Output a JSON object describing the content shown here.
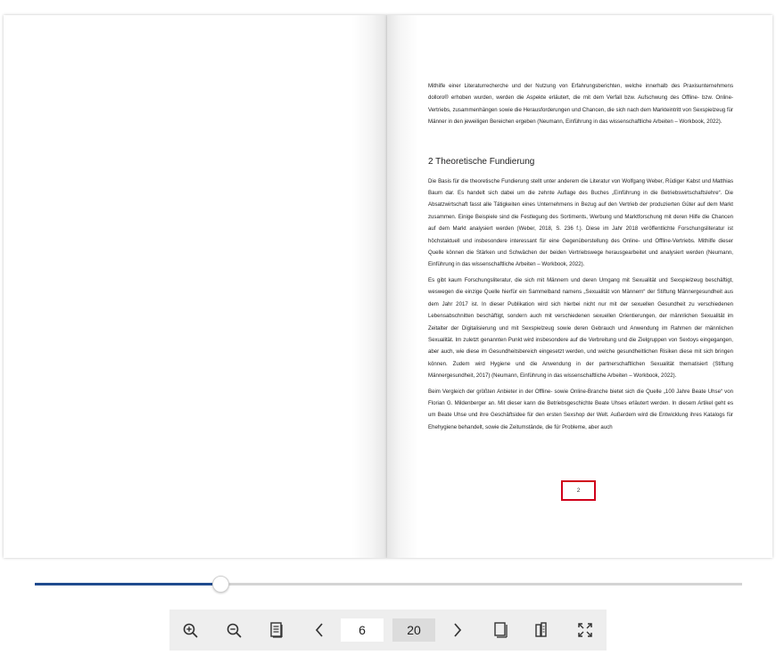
{
  "book": {
    "right_page": {
      "intro_paragraph": "Mithilfe einer Literaturrecherche und der Nutzung von Erfahrungsberichten, welche innerhalb des Praxisunternehmens dolloro® erhoben wurden, werden die Aspekte erläutert, die mit dem Verfall bzw. Aufschwung des Offline- bzw. Online-Vertriebs, zusammenhängen sowie die Herausforderungen und Chancen, die sich nach dem Markteintritt von Sexspielzeug für Männer in den jeweiligen Bereichen ergeben (Neumann, Einführung in das wissenschaftliche Arbeiten – Workbook, 2022).",
      "heading": "2 Theoretische Fundierung",
      "paragraphs": [
        "Die Basis für die theoretische Fundierung stellt unter anderem die Literatur von Wolfgang Weber, Rüdiger Kabst und Matthias Baum dar. Es handelt sich dabei um die zehnte Auflage des Buches „Einführung in die Betriebswirtschaftslehre“. Die Absatzwirtschaft fasst alle Tätigkeiten eines Unternehmens in Bezug auf den Vertrieb der produzierten Güter auf dem Markt zusammen. Einige Beispiele sind die Festlegung des Sortiments, Werbung und Marktforschung mit deren Hilfe die Chancen auf dem Markt analysiert werden (Weber, 2018, S. 236 f.). Diese im Jahr 2018 veröffentlichte Forschungsliteratur ist höchstaktuell und insbesondere interessant für eine Gegenüberstellung des Online- und Offline-Vertriebs. Mithilfe dieser Quelle können die Stärken und Schwächen der beiden Vertriebswege herausgearbeitet und analysiert werden (Neumann, Einführung in das wissenschaftliche Arbeiten – Workbook, 2022).",
        "Es gibt kaum Forschungsliteratur, die sich mit Männern und deren Umgang mit Sexualität und Sexspielzeug beschäftigt, weswegen die einzige Quelle hierfür ein Sammelband namens „Sexualität von Männern“ der Stiftung Männergesundheit aus dem Jahr 2017 ist. In dieser Publikation wird sich hierbei nicht nur mit der sexuellen Gesundheit zu verschiedenen Lebensabschnitten beschäftigt, sondern auch mit verschiedenen sexuellen Orientierungen, der männlichen Sexualität im Zeitalter der Digitalisierung und mit Sexspielzeug sowie deren Gebrauch und Anwendung im Rahmen der männlichen Sexualität. Im zuletzt genannten Punkt wird insbesondere auf die Verbreitung und die Zielgruppen von Sextoys eingegangen, aber auch, wie diese im Gesundheitsbereich eingesetzt werden, und welche gesundheitlichen Risiken diese mit sich bringen können. Zudem wird Hygiene und die Anwendung in der partnerschaftlichen Sexualität thematisiert (Stiftung Männergesundheit, 2017) (Neumann, Einführung in das wissenschaftliche Arbeiten – Workbook, 2022).",
        "Beim Vergleich der größten Anbieter in der Offline- sowie Online-Branche bietet sich die Quelle „100 Jahre Beate Uhse“ von Florian G. Mildenberger an. Mit dieser kann die Betriebsgeschichte Beate Uhses erläutert werden. In diesem Artikel geht es um Beate Uhse und ihre Geschäftsidee für den ersten Sexshop der Welt. Außerdem wird die Entwicklung ihres Katalogs für Ehehygiene behandelt, sowie die Zeitumstände, die für Probleme, aber auch"
      ],
      "page_number": "2"
    }
  },
  "slider": {
    "progress_percent": 26.2
  },
  "toolbar": {
    "zoom_in_icon": "zoom-in-icon",
    "zoom_out_icon": "zoom-out-icon",
    "table_of_contents_icon": "document-list-icon",
    "prev_icon": "chevron-left-icon",
    "current_page": "6",
    "total_pages": "20",
    "next_icon": "chevron-right-icon",
    "single_page_icon": "single-page-icon",
    "double_page_icon": "double-page-icon",
    "fullscreen_icon": "fullscreen-icon"
  }
}
